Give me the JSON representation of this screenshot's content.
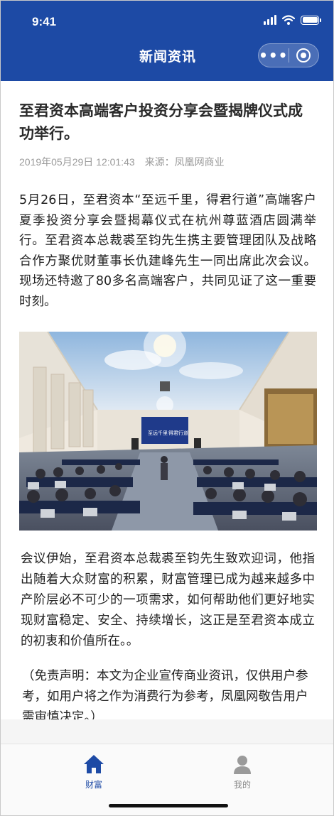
{
  "status_bar": {
    "time": "9:41"
  },
  "nav": {
    "title": "新闻资讯",
    "more_icon": "more-dots-icon",
    "close_icon": "target-close-icon"
  },
  "article": {
    "title": "至君资本高端客户投资分享会暨揭牌仪式成功举行。",
    "date": "2019年05月29日 12:01:43",
    "source": "来源：凤凰网商业",
    "paragraph1": "5月26日，至君资本“至远千里，得君行道”高端客户夏季投资分享会暨揭幕仪式在杭州尊蓝酒店圆满举行。至君资本总裁裘至钧先生携主要管理团队及战略合作方聚优财董事长仇建峰先生一同出席此次会议。现场还特邀了80多名高端客户，共同见证了这一重要时刻。",
    "photo": {
      "screen_text_left": "至远千里",
      "screen_text_right": "得君行道"
    },
    "paragraph2": "会议伊始，至君资本总裁裘至钧先生致欢迎词，他指出随着大众财富的积累，财富管理已成为越来越多中产阶层必不可少的一项需求，如何帮助他们更好地实现财富稳定、安全、持续增长，这正是至君资本成立的初衷和价值所在。。",
    "paragraph3": "（免责声明：本文为企业宣传商业资讯，仅供用户参考，如用户将之作为消费行为参考，凤凰网敬告用户需审慎决定。）"
  },
  "tabbar": {
    "tabs": [
      {
        "label": "财富",
        "icon": "home-icon",
        "active": true
      },
      {
        "label": "我的",
        "icon": "person-icon",
        "active": false
      }
    ]
  },
  "colors": {
    "brand": "#1d4aa5",
    "inactive": "#9a9a9a"
  }
}
